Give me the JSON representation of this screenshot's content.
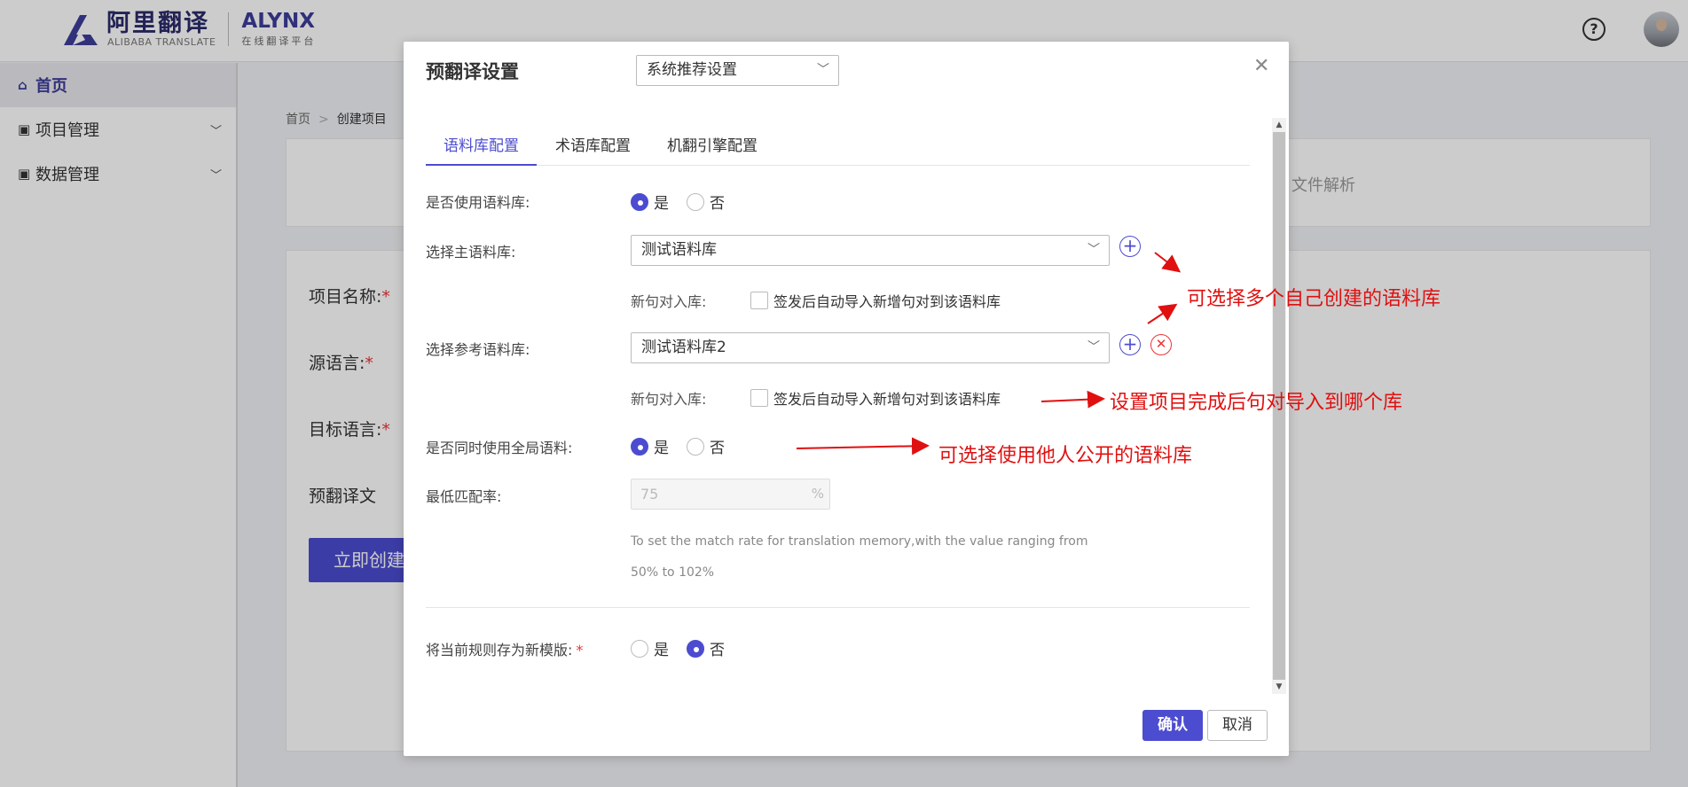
{
  "app": {
    "logo_cn": "阿里翻译",
    "logo_en": "ALIBABA TRANSLATE",
    "brand": "ALYNX",
    "brand_sub": "在线翻译平台",
    "help_icon": "question-circle-icon",
    "colors": {
      "accent": "#4c4cd0",
      "brand": "#3d3d9a",
      "danger": "#e33333",
      "annotation": "#e01010"
    }
  },
  "sidebar": {
    "items": [
      {
        "label": "首页",
        "icon": "home-icon"
      },
      {
        "label": "项目管理",
        "icon": "image-icon"
      },
      {
        "label": "数据管理",
        "icon": "image-icon"
      }
    ]
  },
  "breadcrumb": {
    "home": "首页",
    "current": "创建项目"
  },
  "background_form": {
    "step_label": "文件解析",
    "project_name": "项目名称:",
    "source_lang": "源语言:",
    "target_lang": "目标语言:",
    "pretranslate": "预翻译文",
    "required_mark": "*",
    "create_button": "立即创建"
  },
  "modal": {
    "title": "预翻译设置",
    "template_select": "系统推荐设置",
    "tabs": [
      "语料库配置",
      "术语库配置",
      "机翻引擎配置"
    ],
    "use_tm": {
      "label": "是否使用语料库:",
      "yes": "是",
      "no": "否",
      "selected": "是"
    },
    "main_tm": {
      "label": "选择主语料库:",
      "value": "测试语料库"
    },
    "new_pair_label": "新句对入库:",
    "auto_import_label": "签发后自动导入新增句对到该语料库",
    "ref_tm": {
      "label": "选择参考语料库:",
      "value": "测试语料库2"
    },
    "global_tm": {
      "label": "是否同时使用全局语料:",
      "yes": "是",
      "no": "否",
      "selected": "是"
    },
    "min_match": {
      "label": "最低匹配率:",
      "placeholder": "75",
      "unit": "%"
    },
    "hint_line1": "To set the match rate for translation memory,with the value ranging from",
    "hint_line2": "50% to 102%",
    "save_template": {
      "label": "将当前规则存为新模版:",
      "required": "*",
      "yes": "是",
      "no": "否",
      "selected": "否"
    },
    "confirm": "确认",
    "cancel": "取消"
  },
  "annotations": {
    "multi_tm": "可选择多个自己创建的语料库",
    "import_target": "设置项目完成后句对导入到哪个库",
    "public_tm": "可选择使用他人公开的语料库"
  }
}
